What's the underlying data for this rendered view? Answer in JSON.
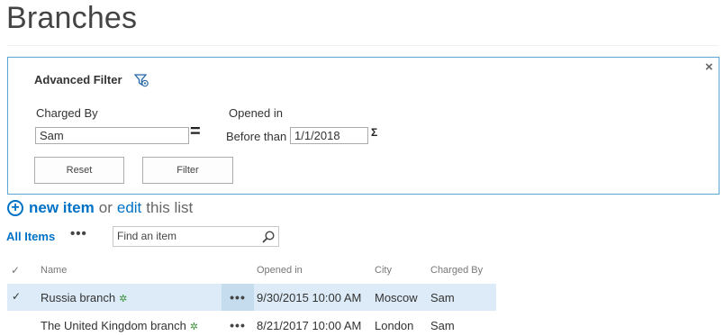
{
  "page": {
    "title": "Branches"
  },
  "filter": {
    "title": "Advanced Filter",
    "close_label": "×",
    "charged_by_label": "Charged By",
    "charged_by_value": "Sam",
    "operator_symbol": "=",
    "opened_in_label": "Opened in",
    "before_label": "Before than",
    "date_value": "1/1/2018",
    "sigma_symbol": "Σ",
    "reset_label": "Reset",
    "filter_label": "Filter"
  },
  "commands": {
    "new_item_label": "new item",
    "or_text": "or",
    "edit_label": "edit",
    "this_list_text": "this list"
  },
  "view": {
    "current_view": "All Items",
    "ellipsis": "•••",
    "search_placeholder": "Find an item"
  },
  "table": {
    "columns": [
      "Name",
      "Opened in",
      "City",
      "Charged By"
    ],
    "rows": [
      {
        "name": "Russia branch",
        "opened": "9/30/2015 10:00 AM",
        "city": "Moscow",
        "charged_by": "Sam",
        "selected": true
      },
      {
        "name": "The United Kingdom branch",
        "opened": "8/21/2017 10:00 AM",
        "city": "London",
        "charged_by": "Sam",
        "selected": false
      }
    ]
  },
  "colors": {
    "accent": "#0072c6",
    "panel_border": "#5aa7d1",
    "selected_row": "#dcebf7",
    "new_marker": "#3e8f3e"
  },
  "icons": [
    "filter-icon",
    "close-icon",
    "plus-circle-icon",
    "search-icon",
    "checkmark-icon",
    "new-item-marker-icon",
    "ellipsis-icon"
  ]
}
